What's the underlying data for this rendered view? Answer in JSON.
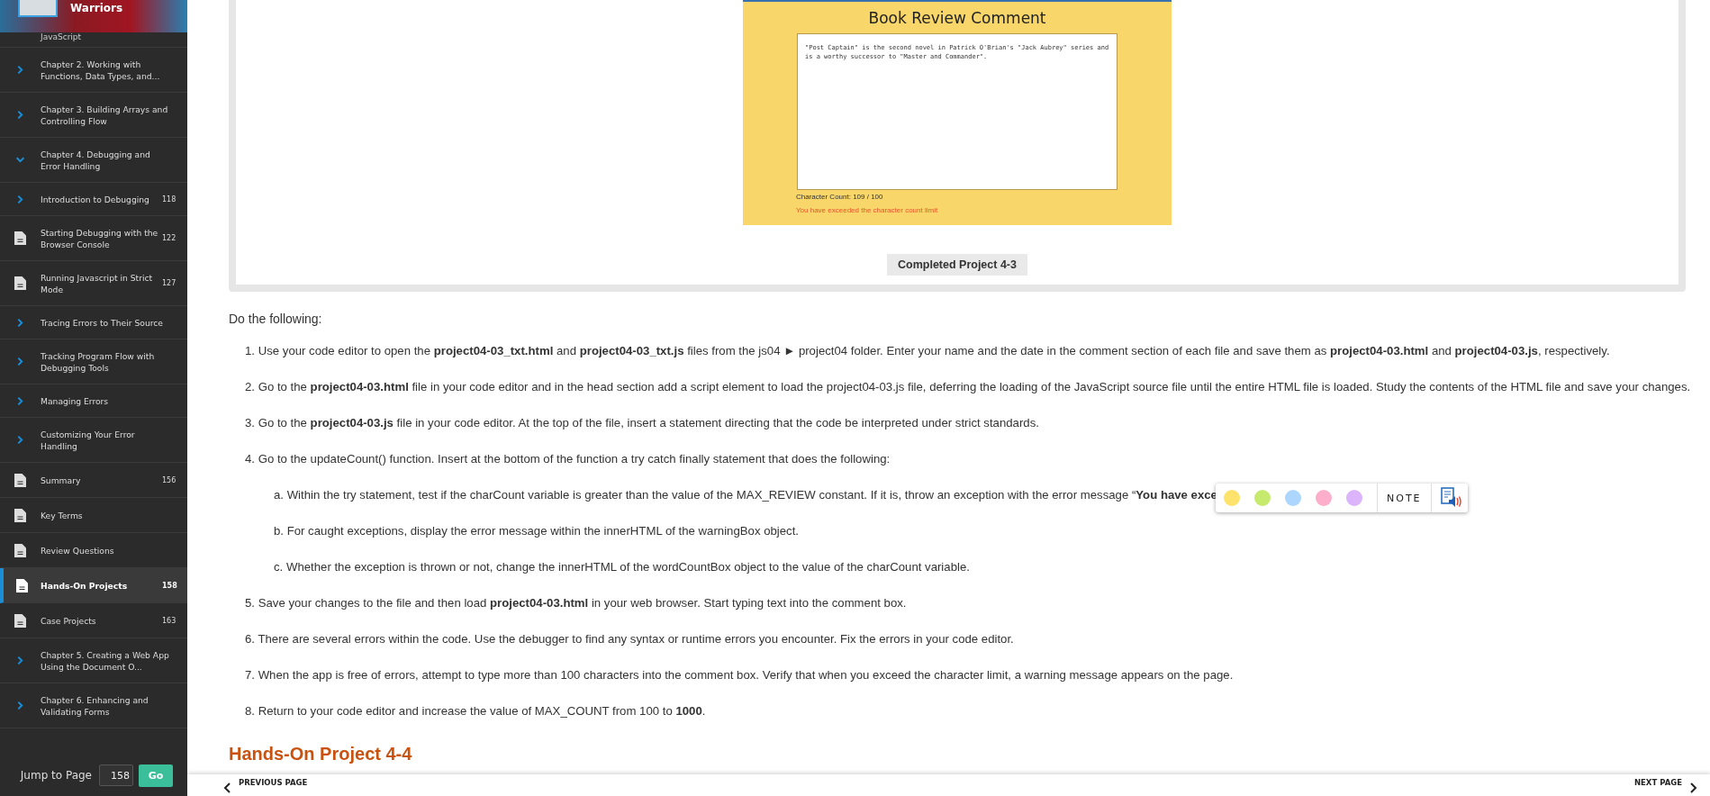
{
  "sidebar": {
    "book_title": "Warriors",
    "partial_item": "JavaScript",
    "items": [
      {
        "label": "Chapter 2. Working with Functions, Data Types, and...",
        "kind": "folder",
        "expanded": false,
        "selected": false
      },
      {
        "label": "Chapter 3. Building Arrays and Controlling Flow",
        "kind": "folder",
        "expanded": false,
        "selected": false
      },
      {
        "label": "Chapter 4. Debugging and Error Handling",
        "kind": "folder",
        "expanded": true,
        "selected": false
      },
      {
        "label": "Introduction to Debugging",
        "kind": "folder",
        "expanded": false,
        "page": "118",
        "selected": false
      },
      {
        "label": "Starting Debugging with the Browser Console",
        "kind": "page",
        "page": "122",
        "selected": false
      },
      {
        "label": "Running Javascript in Strict Mode",
        "kind": "page",
        "page": "127",
        "selected": false
      },
      {
        "label": "Tracing Errors to Their Source",
        "kind": "folder",
        "expanded": false,
        "selected": false
      },
      {
        "label": "Tracking Program Flow with Debugging Tools",
        "kind": "folder",
        "expanded": false,
        "selected": false
      },
      {
        "label": "Managing Errors",
        "kind": "folder",
        "expanded": false,
        "selected": false
      },
      {
        "label": "Customizing Your Error Handling",
        "kind": "folder",
        "expanded": false,
        "selected": false
      },
      {
        "label": "Summary",
        "kind": "page",
        "page": "156",
        "selected": false
      },
      {
        "label": "Key Terms",
        "kind": "page",
        "selected": false
      },
      {
        "label": "Review Questions",
        "kind": "page",
        "selected": false
      },
      {
        "label": "Hands-On Projects",
        "kind": "page",
        "page": "158",
        "selected": true
      },
      {
        "label": "Case Projects",
        "kind": "page",
        "page": "163",
        "selected": false
      },
      {
        "label": "Chapter 5. Creating a Web App Using the Document O...",
        "kind": "folder",
        "expanded": false,
        "selected": false
      },
      {
        "label": "Chapter 6. Enhancing and Validating Forms",
        "kind": "folder",
        "expanded": false,
        "selected": false
      }
    ],
    "jump_label": "Jump to Page",
    "jump_value": "158",
    "go_button": "Go"
  },
  "figure": {
    "app_title": "Book Review Comment",
    "comment_value": "\"Post Captain\" is the second novel in Patrick O'Brian's \"Jack Aubrey\" series and is a worthy successor to \"Master and Commander\".",
    "character_count": "Character Count: 109 / 100",
    "warning": "You have exceeded the character count limit",
    "caption": "Completed Project 4-3"
  },
  "intro": "Do the following:",
  "steps": [
    {
      "number": "1.",
      "text": "Use your code editor to open the **project04-03_txt.html** and **project04-03_txt.js** files from the js04 ► project04 folder. Enter your name and the date in the comment section of each file and save them as **project04-03.html** and **project04-03.js**, respectively."
    },
    {
      "number": "2.",
      "text": "Go to the **project04-03.html** file in your code editor and in the head section add a script element to load the project04-03.js file, deferring the loading of the JavaScript source file until the entire HTML file is loaded. Study the contents of the HTML file and save your changes."
    },
    {
      "number": "3.",
      "text": "Go to the **project04-03.js** file in your code editor. At the top of the file, insert a statement directing that the code be interpreted under strict standards."
    },
    {
      "number": "4.",
      "text": "Go to the updateCount() function. Insert at the bottom of the function a try catch finally statement that does the following:",
      "substeps": [
        {
          "number": "a.",
          "text": "Within the try statement, test if the charCount variable is greater than the value of the MAX_REVIEW constant. If it is, throw an exception with the error message “**You have exce**"
        },
        {
          "number": "b.",
          "text": "For caught exceptions, display the error message within the innerHTML of the warningBox object."
        },
        {
          "number": "c.",
          "text": "Whether the exception is thrown or not, change the innerHTML of the wordCountBox object to the value of the charCount variable."
        }
      ]
    },
    {
      "number": "5.",
      "text": "Save your changes to the file and then load **project04-03.html** in your web browser. Start typing text into the comment box."
    },
    {
      "number": "6.",
      "text": "There are several errors within the code. Use the debugger to find any syntax or runtime errors you encounter. Fix the errors in your code editor."
    },
    {
      "number": "7.",
      "text": "When the app is free of errors, attempt to type more than 100 characters into the comment box. Verify that when you exceed the character limit, a warning message appears on the page."
    },
    {
      "number": "8.",
      "text": "Return to your code editor and increase the value of MAX_COUNT from 100 to **1000**."
    }
  ],
  "next_heading": "Hands-On Project 4-4",
  "highlight_toolbar": {
    "swatches": [
      {
        "color": "#fde36b"
      },
      {
        "color": "#c5ea6e"
      },
      {
        "color": "#acd6fd"
      },
      {
        "color": "#fdaecb"
      },
      {
        "color": "#dbb4fb"
      }
    ],
    "note": "NOTE"
  },
  "footer": {
    "previous": "PREVIOUS PAGE",
    "next": "NEXT PAGE"
  }
}
